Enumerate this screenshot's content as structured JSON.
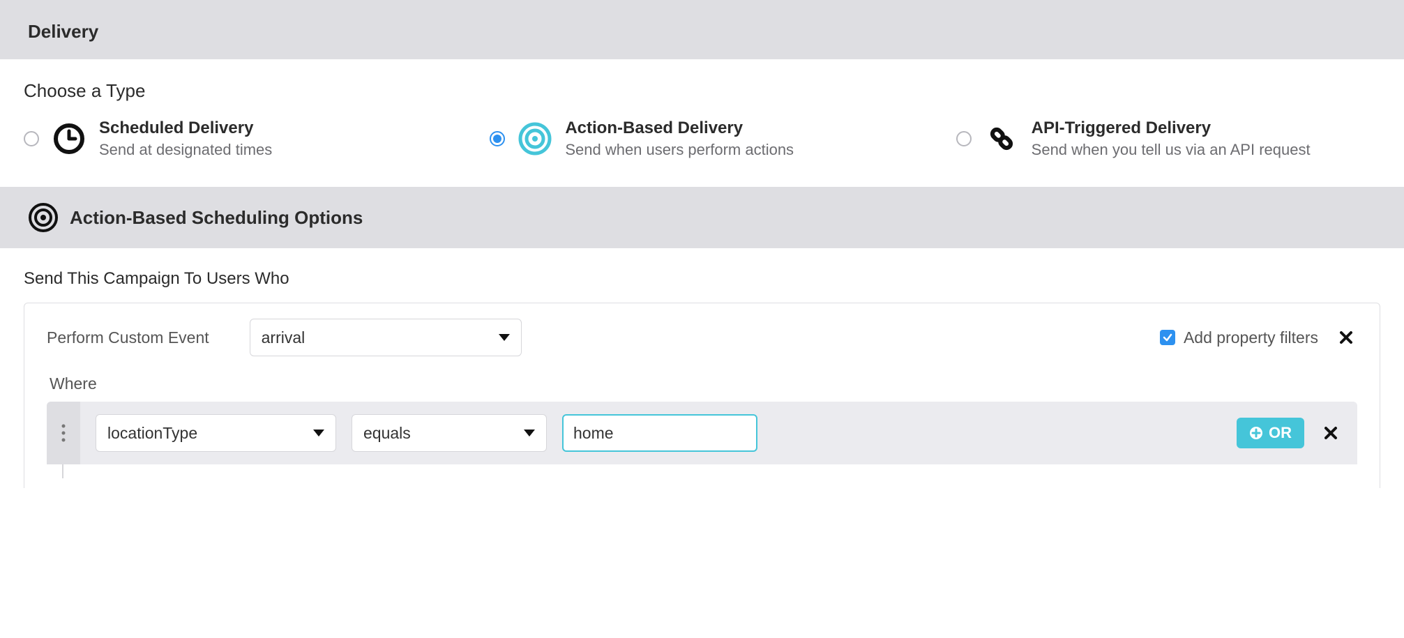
{
  "delivery_header": "Delivery",
  "choose_type_title": "Choose a Type",
  "types": {
    "scheduled": {
      "title": "Scheduled Delivery",
      "sub": "Send at designated times"
    },
    "action": {
      "title": "Action-Based Delivery",
      "sub": "Send when users perform actions"
    },
    "api": {
      "title": "API-Triggered Delivery",
      "sub": "Send when you tell us via an API request"
    }
  },
  "scheduling_header": "Action-Based Scheduling Options",
  "send_to_title": "Send This Campaign To Users Who",
  "perform_label": "Perform Custom Event",
  "event_select": "arrival",
  "add_filters_label": "Add property filters",
  "where_label": "Where",
  "filter": {
    "property": "locationType",
    "operator": "equals",
    "value": "home"
  },
  "or_label": "OR",
  "colors": {
    "accent": "#45c5d9",
    "blue": "#2d91f0"
  }
}
